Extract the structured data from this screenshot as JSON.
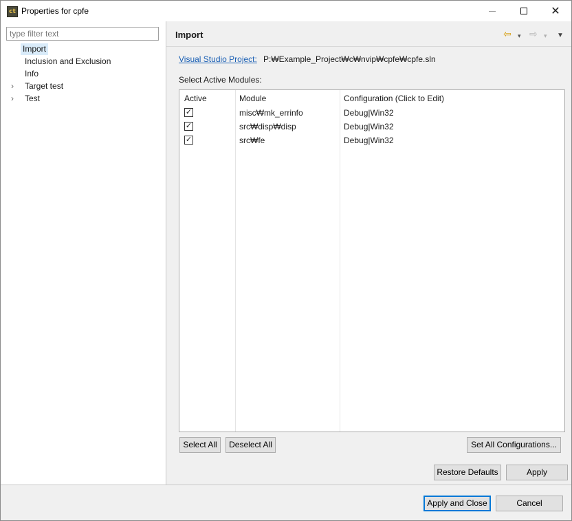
{
  "window": {
    "title": "Properties for cpfe",
    "icon_label": "ct",
    "controls": {
      "minimize": "minimize-icon",
      "maximize": "maximize-icon",
      "close": "✕"
    }
  },
  "sidebar": {
    "filter_placeholder": "type filter text",
    "items": [
      {
        "label": "Import",
        "selected": true,
        "expandable": false
      },
      {
        "label": "Inclusion and Exclusion",
        "selected": false,
        "expandable": false
      },
      {
        "label": "Info",
        "selected": false,
        "expandable": false
      },
      {
        "label": "Target test",
        "selected": false,
        "expandable": true
      },
      {
        "label": "Test",
        "selected": false,
        "expandable": true
      }
    ]
  },
  "page": {
    "title": "Import",
    "nav": {
      "back": "⇦",
      "forward": "⇨",
      "dropdown": "▾",
      "menu": "▼"
    },
    "project_link": "Visual Studio Project:",
    "project_path": "P:₩Example_Project₩c₩nvip₩cpfe₩cpfe.sln",
    "modules_label": "Select Active Modules:",
    "table": {
      "headers": [
        "Active",
        "Module",
        "Configuration (Click to Edit)"
      ],
      "rows": [
        {
          "active": true,
          "module": "misc₩mk_errinfo",
          "configuration": "Debug|Win32"
        },
        {
          "active": true,
          "module": "src₩disp₩disp",
          "configuration": "Debug|Win32"
        },
        {
          "active": true,
          "module": "src₩fe",
          "configuration": "Debug|Win32"
        }
      ]
    },
    "buttons": {
      "select_all": "Select All",
      "deselect_all": "Deselect All",
      "set_all_configurations": "Set All Configurations...",
      "restore_defaults": "Restore Defaults",
      "apply": "Apply"
    }
  },
  "footer": {
    "apply_and_close": "Apply and Close",
    "cancel": "Cancel"
  },
  "colors": {
    "accent": "#0078d7",
    "link": "#1a5fb4",
    "selection": "#d9ebf9",
    "back_arrow": "#d8a21a"
  }
}
